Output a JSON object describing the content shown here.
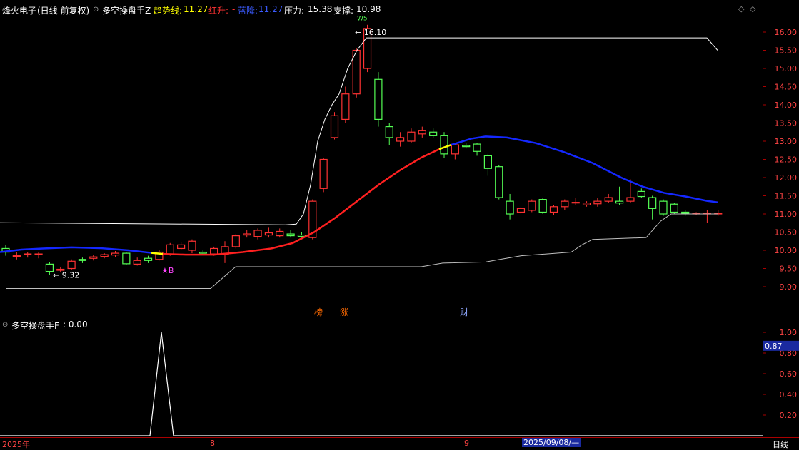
{
  "header": {
    "stock": "烽火电子",
    "period": "(日线 前复权)",
    "indicator": "多空操盘手Z",
    "trend_label": "趋势线:",
    "trend_value": "11.27",
    "red_label": "红升:",
    "red_value": "-",
    "blue_label": "蓝降:",
    "blue_value": "11.27",
    "pressure_label": "压力:",
    "pressure_value": "15.38",
    "support_label": "支撑:",
    "support_value": "10.98"
  },
  "subpanel": {
    "title": "多空操盘手F",
    "value": ": 0.00",
    "current_value": "0.87",
    "ticks": [
      "1.00",
      "0.80",
      "0.60",
      "0.40",
      "0.20"
    ]
  },
  "dates": {
    "start": "2025年",
    "m8": "8",
    "m9": "9",
    "cursor_date": "2025/09/08/—",
    "period_label": "日线"
  },
  "annotations": {
    "low_price": "9.32",
    "high_price": "16.10",
    "b_signal": "★B",
    "tags": [
      "榜",
      "涨",
      "财"
    ],
    "top_tag": "W5"
  },
  "colors": {
    "up": "#ff3232",
    "down": "#54ff54",
    "trend_red": "#ff2020",
    "trend_blue": "#1428ff",
    "line_white": "#ffffff",
    "axis": "#aa0000",
    "magenta": "#ff44ff",
    "yellow": "#ffff00"
  },
  "chart_data": [
    {
      "type": "candlestick",
      "title": "多空操盘手Z",
      "ylim": [
        8.6,
        16.3
      ],
      "yticks": [
        9.0,
        9.5,
        10.0,
        10.5,
        11.0,
        11.5,
        12.0,
        12.5,
        13.0,
        13.5,
        14.0,
        14.5,
        15.0,
        15.5,
        16.0
      ],
      "candles": [
        [
          10.05,
          9.95,
          10.15,
          9.85
        ],
        [
          9.85,
          9.85,
          9.95,
          9.75
        ],
        [
          9.9,
          9.9,
          9.95,
          9.8
        ],
        [
          9.9,
          9.9,
          9.95,
          9.78
        ],
        [
          9.62,
          9.42,
          9.68,
          9.32
        ],
        [
          9.45,
          9.48,
          9.55,
          9.4
        ],
        [
          9.5,
          9.7,
          9.75,
          9.45
        ],
        [
          9.75,
          9.72,
          9.8,
          9.65
        ],
        [
          9.78,
          9.82,
          9.88,
          9.72
        ],
        [
          9.83,
          9.88,
          9.92,
          9.78
        ],
        [
          9.87,
          9.92,
          9.98,
          9.82
        ],
        [
          9.92,
          9.63,
          9.95,
          9.6
        ],
        [
          9.62,
          9.72,
          9.8,
          9.58
        ],
        [
          9.78,
          9.72,
          9.85,
          9.65
        ],
        [
          9.75,
          9.95,
          10.0,
          9.72
        ],
        [
          9.88,
          10.15,
          10.2,
          9.85
        ],
        [
          10.05,
          10.15,
          10.22,
          10.0
        ],
        [
          10.0,
          10.25,
          10.3,
          9.92
        ],
        [
          9.95,
          9.92,
          10.0,
          9.88
        ],
        [
          9.9,
          10.05,
          10.1,
          9.85
        ],
        [
          9.88,
          10.1,
          10.25,
          9.65
        ],
        [
          10.1,
          10.4,
          10.45,
          10.05
        ],
        [
          10.42,
          10.45,
          10.55,
          10.35
        ],
        [
          10.38,
          10.55,
          10.6,
          10.3
        ],
        [
          10.42,
          10.48,
          10.62,
          10.35
        ],
        [
          10.4,
          10.52,
          10.6,
          10.35
        ],
        [
          10.45,
          10.4,
          10.55,
          10.35
        ],
        [
          10.42,
          10.38,
          10.5,
          10.35
        ],
        [
          10.35,
          11.35,
          11.4,
          10.3
        ],
        [
          11.7,
          12.5,
          12.55,
          11.6
        ],
        [
          13.1,
          13.7,
          13.8,
          13.05
        ],
        [
          13.6,
          14.3,
          14.5,
          13.5
        ],
        [
          14.3,
          15.5,
          15.55,
          14.2
        ],
        [
          15.0,
          16.1,
          16.2,
          14.9
        ],
        [
          14.7,
          13.6,
          14.9,
          13.4
        ],
        [
          13.4,
          13.1,
          13.5,
          12.9
        ],
        [
          13.0,
          13.1,
          13.25,
          12.85
        ],
        [
          13.0,
          13.25,
          13.35,
          12.95
        ],
        [
          13.2,
          13.3,
          13.4,
          13.1
        ],
        [
          13.25,
          13.15,
          13.35,
          13.1
        ],
        [
          13.15,
          12.65,
          13.25,
          12.55
        ],
        [
          12.65,
          12.9,
          12.95,
          12.5
        ],
        [
          12.88,
          12.85,
          12.95,
          12.8
        ],
        [
          12.92,
          12.72,
          12.95,
          12.6
        ],
        [
          12.6,
          12.25,
          12.65,
          12.05
        ],
        [
          12.3,
          11.45,
          12.35,
          11.4
        ],
        [
          11.35,
          11.0,
          11.55,
          10.85
        ],
        [
          11.05,
          11.15,
          11.2,
          11.0
        ],
        [
          11.1,
          11.35,
          11.4,
          11.05
        ],
        [
          11.4,
          11.05,
          11.45,
          11.0
        ],
        [
          11.05,
          11.2,
          11.25,
          10.98
        ],
        [
          11.2,
          11.35,
          11.4,
          11.1
        ],
        [
          11.32,
          11.32,
          11.45,
          11.25
        ],
        [
          11.25,
          11.3,
          11.35,
          11.2
        ],
        [
          11.28,
          11.35,
          11.45,
          11.2
        ],
        [
          11.35,
          11.45,
          11.55,
          11.3
        ],
        [
          11.35,
          11.3,
          11.75,
          11.25
        ],
        [
          11.35,
          11.45,
          11.95,
          11.3
        ],
        [
          11.62,
          11.48,
          11.7,
          11.45
        ],
        [
          11.45,
          11.15,
          11.5,
          10.85
        ],
        [
          11.35,
          11.0,
          11.4,
          10.95
        ],
        [
          11.27,
          11.05,
          11.3,
          11.0
        ],
        [
          11.05,
          11.02,
          11.1,
          10.95
        ],
        [
          11.02,
          11.02,
          11.05,
          10.98
        ],
        [
          11.02,
          11.02,
          11.1,
          10.75
        ],
        [
          11.0,
          11.02,
          11.1,
          10.95
        ]
      ]
    },
    {
      "type": "line",
      "title": "多空操盘手F",
      "ylim": [
        0,
        1.1
      ],
      "series": [
        {
          "values": [
            0,
            0,
            0,
            0,
            0,
            0,
            0,
            0,
            0,
            0,
            0,
            0,
            0,
            0,
            0,
            0,
            1.0,
            0,
            0,
            0,
            0,
            0,
            0,
            0,
            0,
            0,
            0,
            0,
            0,
            0,
            0,
            0,
            0,
            0,
            0,
            0,
            0,
            0,
            0,
            0,
            0,
            0,
            0,
            0,
            0,
            0,
            0,
            0,
            0,
            0,
            0,
            0,
            0,
            0,
            0,
            0,
            0,
            0,
            0,
            0,
            0,
            0,
            0,
            0,
            0,
            0,
            0,
            0,
            0,
            0,
            0,
            0,
            0,
            0,
            0,
            0,
            0,
            0,
            0,
            0,
            0,
            0,
            0,
            0,
            0,
            0,
            0,
            0,
            0
          ]
        }
      ]
    }
  ]
}
